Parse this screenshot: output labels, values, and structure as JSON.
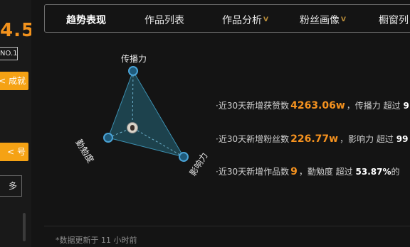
{
  "sidebar": {
    "score": "4.5",
    "rank": "NO.1",
    "achievement_btn": "成就 >",
    "bind_btn": "号 >",
    "more_btn": "多"
  },
  "tabs": [
    {
      "label": "趋势表现",
      "active": true
    },
    {
      "label": "作品列表"
    },
    {
      "label": "作品分析",
      "badge": "V"
    },
    {
      "label": "粉丝画像",
      "badge": "V"
    },
    {
      "label": "橱窗列"
    }
  ],
  "radar": {
    "axis_top": "传播力",
    "axis_left": "勤勉度",
    "axis_right": "影响力"
  },
  "stats": [
    {
      "prefix": "·近30天新增获赞数",
      "value": "4263.06w",
      "middle": "，传播力 超过",
      "pct": "9"
    },
    {
      "prefix": "·近30天新增粉丝数",
      "value": "226.77w",
      "middle": "，影响力 超过",
      "pct": "99"
    },
    {
      "prefix": "·近30天新增作品数",
      "value": "9",
      "middle": "，勤勉度 超过",
      "pct": "53.87%",
      "suffix": "的"
    }
  ],
  "footer": "*数据更新于 11 小时前",
  "colors": {
    "accent": "#f5921f",
    "button": "#f5a214",
    "radar_fill": "#1f4f5f",
    "radar_line": "#3a7fa0"
  }
}
